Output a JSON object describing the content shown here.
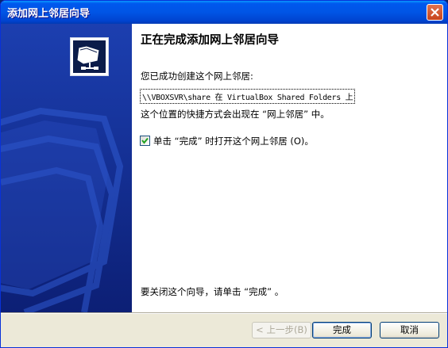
{
  "window": {
    "title": "添加网上邻居向导"
  },
  "content": {
    "heading": "正在完成添加网上邻居向导",
    "created_label": "您已成功创建这个网上邻居:",
    "network_place": "\\\\VBOXSVR\\share 在 VirtualBox Shared Folders 上",
    "shortcut_note": "这个位置的快捷方式会出现在 “网上邻居” 中。",
    "open_checkbox": {
      "label": "单击 “完成” 时打开这个网上邻居 (O)。",
      "checked": true
    },
    "close_hint": "要关闭这个向导，请单击 “完成” 。"
  },
  "buttons": {
    "back": "< 上一步(B)",
    "finish": "完成",
    "cancel": "取消"
  }
}
